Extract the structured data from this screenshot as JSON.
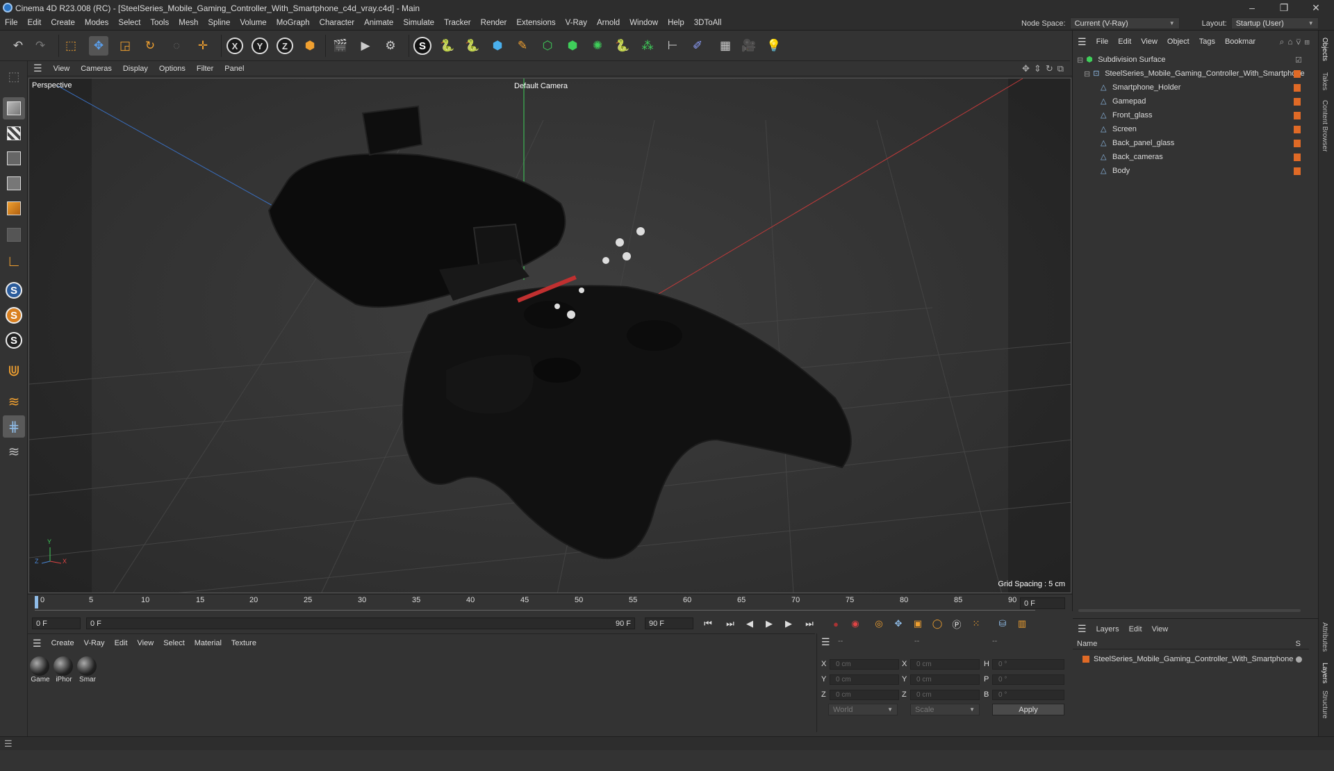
{
  "window": {
    "title": "Cinema 4D R23.008 (RC) - [SteelSeries_Mobile_Gaming_Controller_With_Smartphone_c4d_vray.c4d] - Main",
    "controls": [
      "–",
      "❐",
      "✕"
    ]
  },
  "menubar": [
    "File",
    "Edit",
    "Create",
    "Modes",
    "Select",
    "Tools",
    "Mesh",
    "Spline",
    "Volume",
    "MoGraph",
    "Character",
    "Animate",
    "Simulate",
    "Tracker",
    "Render",
    "Extensions",
    "V-Ray",
    "Arnold",
    "Window",
    "Help",
    "3DToAll"
  ],
  "nodespace": {
    "label": "Node Space:",
    "value": "Current (V-Ray)"
  },
  "layout": {
    "label": "Layout:",
    "value": "Startup (User)"
  },
  "viewport": {
    "menu": [
      "View",
      "Cameras",
      "Display",
      "Options",
      "Filter",
      "Panel"
    ],
    "label": "Perspective",
    "camera": "Default Camera",
    "grid_spacing": "Grid Spacing : 5 cm",
    "axis_labels": {
      "x": "X",
      "y": "Y",
      "z": "Z"
    }
  },
  "timeline": {
    "ticks": [
      "0",
      "5",
      "10",
      "15",
      "20",
      "25",
      "30",
      "35",
      "40",
      "45",
      "50",
      "55",
      "60",
      "65",
      "70",
      "75",
      "80",
      "85",
      "90"
    ],
    "current_frame": "0 F",
    "start": "0 F",
    "range_start": "0 F",
    "range_end": "90 F",
    "end": "90 F"
  },
  "materials": {
    "menu": [
      "Create",
      "V-Ray",
      "Edit",
      "View",
      "Select",
      "Material",
      "Texture"
    ],
    "items": [
      "Game",
      "iPhor",
      "Smar"
    ]
  },
  "coords": {
    "rows": [
      {
        "a": "X",
        "av": "0 cm",
        "b": "X",
        "bv": "0 cm",
        "c": "H",
        "cv": "0 °"
      },
      {
        "a": "Y",
        "av": "0 cm",
        "b": "Y",
        "bv": "0 cm",
        "c": "P",
        "cv": "0 °"
      },
      {
        "a": "Z",
        "av": "0 cm",
        "b": "Z",
        "bv": "0 cm",
        "c": "B",
        "cv": "0 °"
      }
    ],
    "headers": [
      "--",
      "--",
      "--"
    ],
    "space": "World",
    "mode": "Scale",
    "apply": "Apply"
  },
  "objects": {
    "menu": [
      "File",
      "Edit",
      "View",
      "Object",
      "Tags",
      "Bookmar"
    ],
    "tree": [
      {
        "label": "Subdivision Surface",
        "level": 0,
        "tag": false
      },
      {
        "label": "SteelSeries_Mobile_Gaming_Controller_With_Smartphone",
        "level": 1,
        "tag": true
      },
      {
        "label": "Smartphone_Holder",
        "level": 2,
        "tag": true
      },
      {
        "label": "Gamepad",
        "level": 2,
        "tag": true
      },
      {
        "label": "Front_glass",
        "level": 2,
        "tag": true
      },
      {
        "label": "Screen",
        "level": 2,
        "tag": true
      },
      {
        "label": "Back_panel_glass",
        "level": 2,
        "tag": true
      },
      {
        "label": "Back_cameras",
        "level": 2,
        "tag": true
      },
      {
        "label": "Body",
        "level": 2,
        "tag": true
      }
    ]
  },
  "layers": {
    "menu": [
      "Layers",
      "Edit",
      "View"
    ],
    "header_name": "Name",
    "header_s": "S",
    "items": [
      "SteelSeries_Mobile_Gaming_Controller_With_Smartphone"
    ]
  },
  "side_tabs": [
    "Objects",
    "Takes",
    "Content Browser",
    "Attributes",
    "Layers",
    "Structure"
  ],
  "colors": {
    "accent": "#e06a26",
    "bg": "#333333",
    "title": "#2d2d2d",
    "axis_x": "#e04444",
    "axis_y": "#3fcf5a",
    "axis_z": "#4a88d8"
  }
}
